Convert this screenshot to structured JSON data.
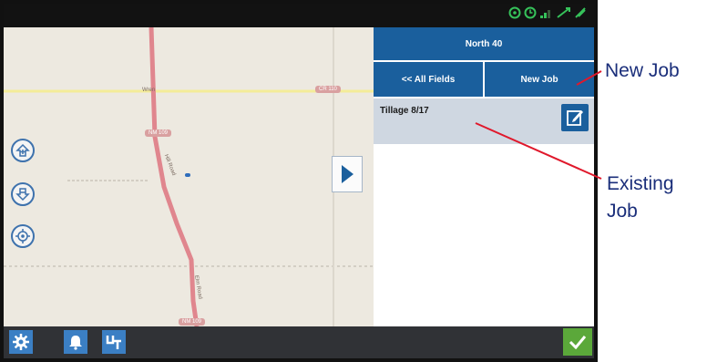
{
  "panel": {
    "field_name": "North 40",
    "all_fields_label": "<< All Fields",
    "new_job_label": "New Job",
    "jobs": [
      {
        "name": "Tillage 8/17",
        "edit_icon": "edit-icon"
      }
    ]
  },
  "map": {
    "road_label_west": "Wren",
    "shield_top": "CR 110",
    "shield_left": "NM 109",
    "shield_bottom": "NM 109",
    "road_label_vertical_1": "Hill Road",
    "road_label_vertical_2": "Elm Road"
  },
  "annotations": {
    "new_job": "New Job",
    "existing_job_line1": "Existing",
    "existing_job_line2": "Job"
  },
  "colors": {
    "panel_blue": "#1a5f9d",
    "job_row": "#cfd7e1",
    "accept_green": "#5ba83a",
    "toolbar_blue": "#3b7fc4",
    "callout_text": "#1a2e7a",
    "callout_line": "#e0182b",
    "road_main": "#e0868e",
    "road_yellow": "#f4ec98"
  },
  "icons": {
    "toolbar": [
      "gear-icon",
      "bell-icon",
      "ut-icon"
    ],
    "accept": "checkmark-icon",
    "map_controls": [
      "zoom-in-home-icon",
      "zoom-out-home-icon",
      "center-target-icon"
    ],
    "expand": "play-arrow-icon"
  }
}
